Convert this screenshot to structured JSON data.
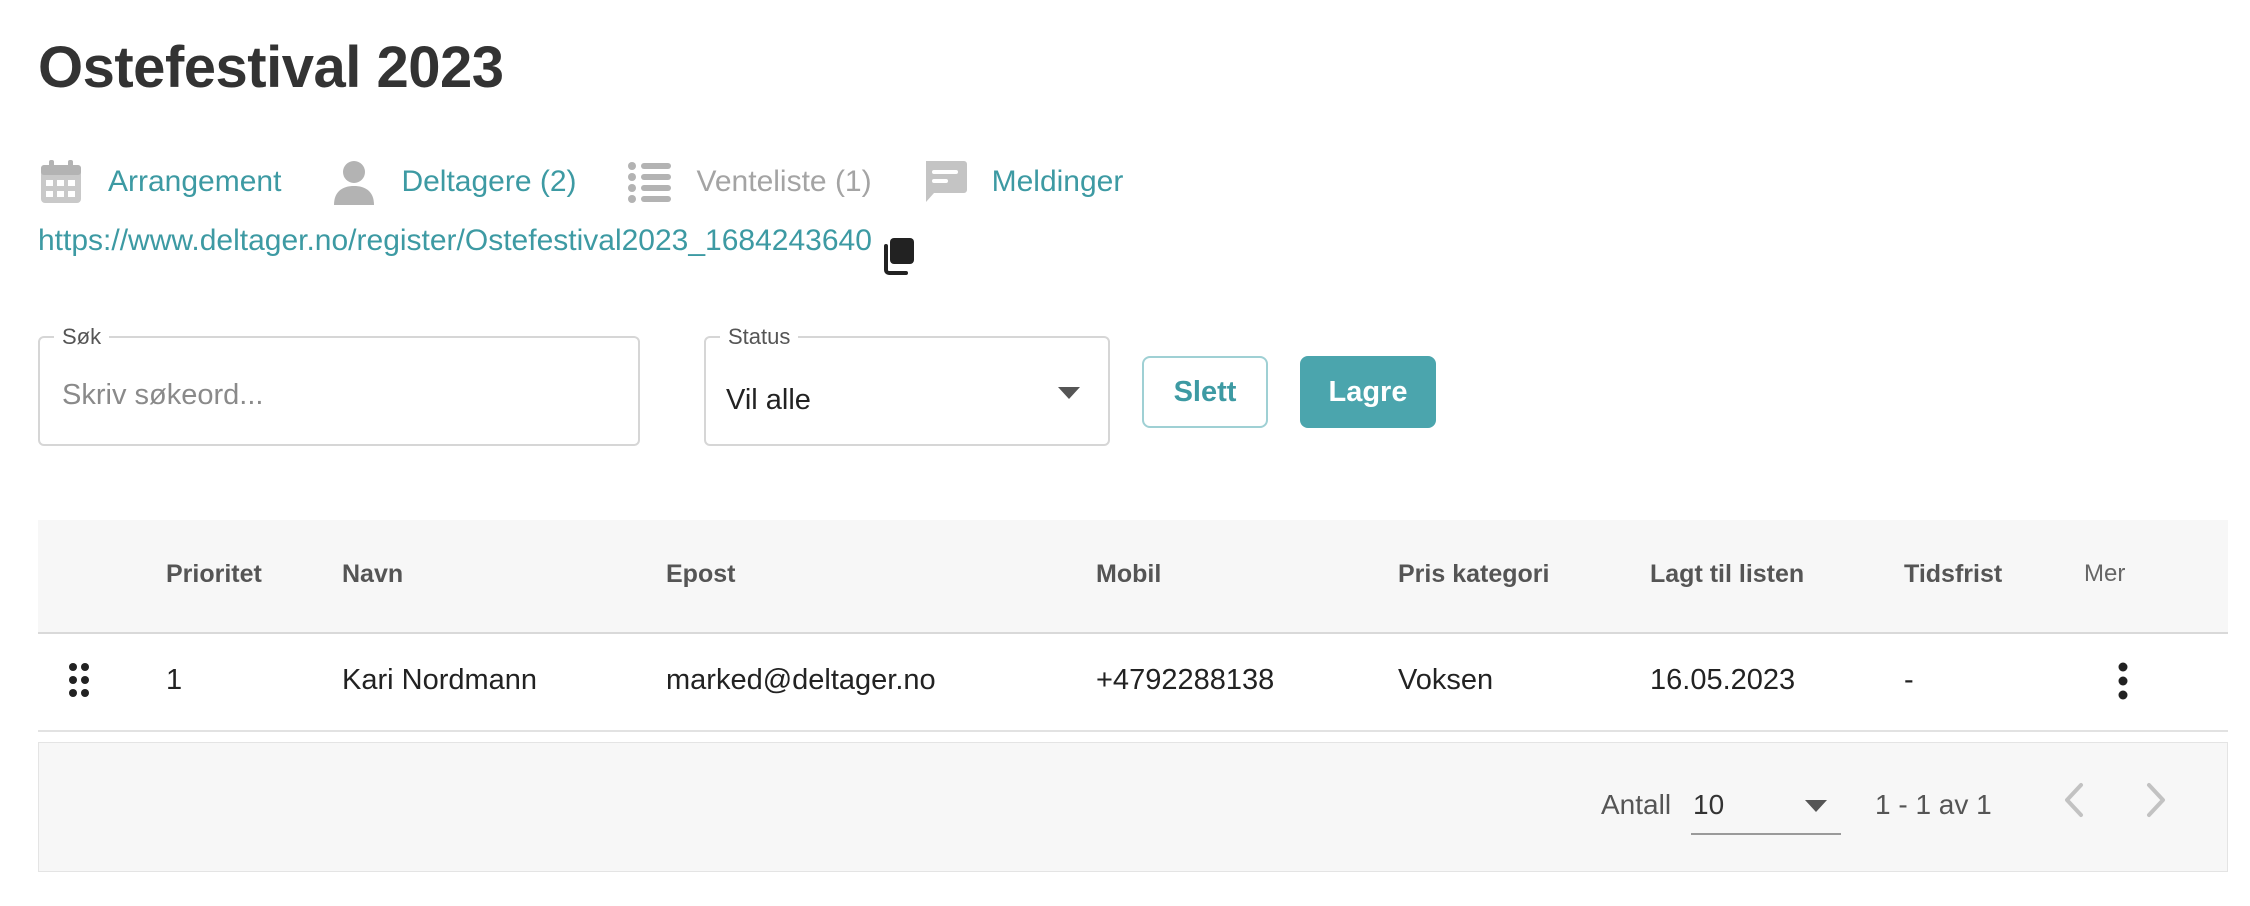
{
  "page": {
    "title": "Ostefestival 2023"
  },
  "nav": [
    {
      "label": "Arrangement",
      "icon": "calendar-icon",
      "state": "active"
    },
    {
      "label": "Deltagere (2)",
      "icon": "person-icon",
      "state": "active"
    },
    {
      "label": "Venteliste (1)",
      "icon": "list-icon",
      "state": "current"
    },
    {
      "label": "Meldinger",
      "icon": "chat-icon",
      "state": "active"
    }
  ],
  "registration_link": {
    "url": "https://www.deltager.no/register/Ostefestival2023_1684243640",
    "icon": "copy-icon"
  },
  "filters": {
    "search": {
      "label": "Søk",
      "placeholder": "Skriv søkeord...",
      "value": ""
    },
    "status": {
      "label": "Status",
      "value": "Vil alle"
    }
  },
  "actions": {
    "delete_label": "Slett",
    "save_label": "Lagre"
  },
  "table": {
    "columns": [
      "Prioritet",
      "Navn",
      "Epost",
      "Mobil",
      "Pris kategori",
      "Lagt til listen",
      "Tidsfrist",
      "Mer"
    ],
    "rows": [
      {
        "prioritet": "1",
        "navn": "Kari Nordmann",
        "epost": "marked@deltager.no",
        "mobil": "+4792288138",
        "pris_kategori": "Voksen",
        "lagt_til": "16.05.2023",
        "tidsfrist": "-"
      }
    ]
  },
  "pagination": {
    "rows_label": "Antall",
    "rows_value": "10",
    "range": "1 - 1 av 1"
  },
  "colors": {
    "accent": "#3d9aa3",
    "primary_button": "#4ba5ad",
    "muted": "#a4a4a4",
    "header_bg": "#f7f7f7"
  }
}
